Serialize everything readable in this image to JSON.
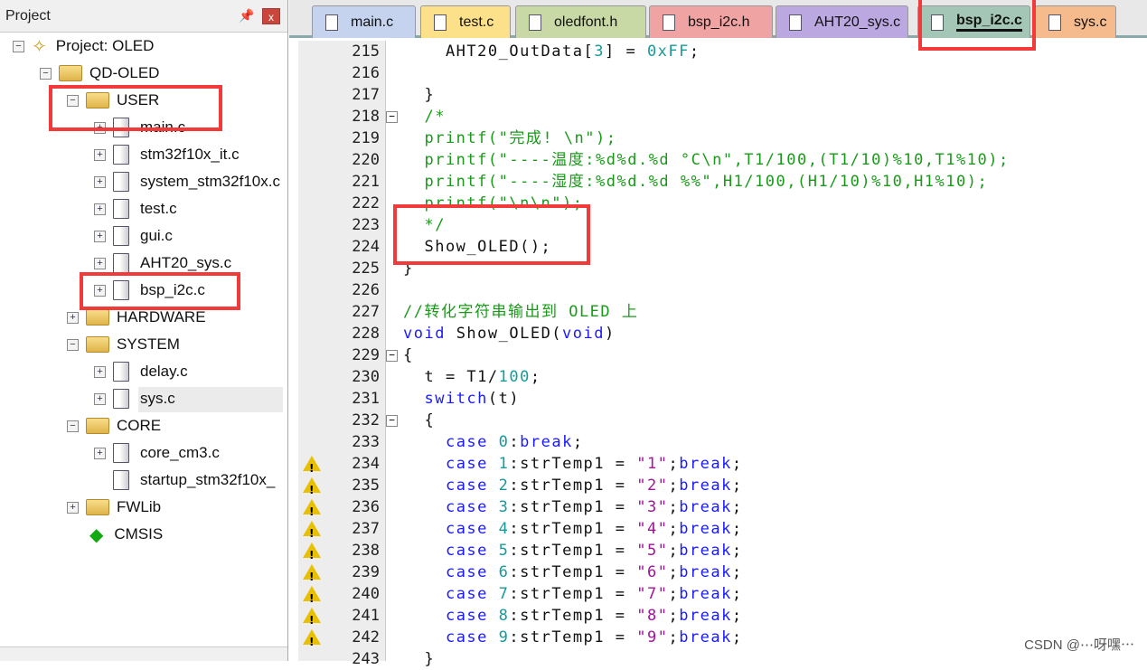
{
  "project_panel": {
    "title": "Project",
    "pin_icon": "pin-icon",
    "close_label": "x",
    "tree": [
      {
        "label": "Project: OLED",
        "icon": "project-icon",
        "expander": "−",
        "depth": 0
      },
      {
        "label": "QD-OLED",
        "icon": "target-folder-icon",
        "expander": "−",
        "depth": 1
      },
      {
        "label": "USER",
        "icon": "folder-open-icon",
        "expander": "−",
        "depth": 2
      },
      {
        "label": "main.c",
        "icon": "file-icon",
        "expander": "+",
        "depth": 3
      },
      {
        "label": "stm32f10x_it.c",
        "icon": "file-icon",
        "expander": "+",
        "depth": 3
      },
      {
        "label": "system_stm32f10x.c",
        "icon": "file-icon",
        "expander": "+",
        "depth": 3
      },
      {
        "label": "test.c",
        "icon": "file-icon",
        "expander": "+",
        "depth": 3
      },
      {
        "label": "gui.c",
        "icon": "file-icon",
        "expander": "+",
        "depth": 3
      },
      {
        "label": "AHT20_sys.c",
        "icon": "file-icon",
        "expander": "+",
        "depth": 3
      },
      {
        "label": "bsp_i2c.c",
        "icon": "file-icon",
        "expander": "+",
        "depth": 3
      },
      {
        "label": "HARDWARE",
        "icon": "folder-icon",
        "expander": "+",
        "depth": 2
      },
      {
        "label": "SYSTEM",
        "icon": "folder-open-icon",
        "expander": "−",
        "depth": 2
      },
      {
        "label": "delay.c",
        "icon": "file-icon",
        "expander": "+",
        "depth": 3
      },
      {
        "label": "sys.c",
        "icon": "file-icon",
        "expander": "+",
        "depth": 3,
        "selected": true
      },
      {
        "label": "CORE",
        "icon": "folder-open-icon",
        "expander": "−",
        "depth": 2
      },
      {
        "label": "core_cm3.c",
        "icon": "file-icon",
        "expander": "+",
        "depth": 3
      },
      {
        "label": "startup_stm32f10x_",
        "icon": "file-icon",
        "expander": "",
        "depth": 3
      },
      {
        "label": "FWLib",
        "icon": "folder-icon",
        "expander": "+",
        "depth": 2
      },
      {
        "label": "CMSIS",
        "icon": "cmsis-icon",
        "expander": "",
        "depth": 2
      }
    ]
  },
  "tabs": [
    {
      "label": "main.c",
      "color": "#c5d3ee"
    },
    {
      "label": "test.c",
      "color": "#fde08a"
    },
    {
      "label": "oledfont.h",
      "color": "#c9d9a6"
    },
    {
      "label": "bsp_i2c.h",
      "color": "#f0a3a3"
    },
    {
      "label": "AHT20_sys.c",
      "color": "#bba8e0"
    },
    {
      "label": "bsp_i2c.c",
      "color": "#a3c6b6",
      "active": true
    },
    {
      "label": "sys.c",
      "color": "#f6bb8c"
    }
  ],
  "editor": {
    "lines": [
      {
        "n": "215",
        "seg": [
          [
            "n",
            "    AHT20_OutData["
          ],
          [
            "nu",
            "3"
          ],
          [
            "n",
            "] = "
          ],
          [
            "nu",
            "0xFF"
          ],
          [
            "n",
            ";"
          ]
        ]
      },
      {
        "n": "216",
        "seg": []
      },
      {
        "n": "217",
        "seg": [
          [
            "n",
            "  }"
          ]
        ]
      },
      {
        "n": "218",
        "fold": "−",
        "seg": [
          [
            "c",
            "  /*"
          ]
        ]
      },
      {
        "n": "219",
        "seg": [
          [
            "c",
            "  printf(\"完成! \\n\");"
          ]
        ]
      },
      {
        "n": "220",
        "seg": [
          [
            "c",
            "  printf(\"----温度:%d%d.%d °C\\n\",T1/100,(T1/10)%10,T1%10);"
          ]
        ]
      },
      {
        "n": "221",
        "seg": [
          [
            "c",
            "  printf(\"----湿度:%d%d.%d %%\",H1/100,(H1/10)%10,H1%10);"
          ]
        ]
      },
      {
        "n": "222",
        "seg": [
          [
            "c",
            "  printf(\"\\n\\n\");"
          ]
        ]
      },
      {
        "n": "223",
        "seg": [
          [
            "c",
            "  */"
          ]
        ]
      },
      {
        "n": "224",
        "seg": [
          [
            "n",
            "  Show_OLED();"
          ]
        ]
      },
      {
        "n": "225",
        "seg": [
          [
            "n",
            "}"
          ]
        ]
      },
      {
        "n": "226",
        "seg": []
      },
      {
        "n": "227",
        "seg": [
          [
            "c",
            "//转化字符串输出到 OLED 上"
          ]
        ]
      },
      {
        "n": "228",
        "seg": [
          [
            "k",
            "void"
          ],
          [
            "n",
            " Show_OLED("
          ],
          [
            "k",
            "void"
          ],
          [
            "n",
            ")"
          ]
        ]
      },
      {
        "n": "229",
        "fold": "−",
        "seg": [
          [
            "n",
            "{"
          ]
        ]
      },
      {
        "n": "230",
        "seg": [
          [
            "n",
            "  t = T1/"
          ],
          [
            "nu",
            "100"
          ],
          [
            "n",
            ";"
          ]
        ]
      },
      {
        "n": "231",
        "seg": [
          [
            "n",
            "  "
          ],
          [
            "k",
            "switch"
          ],
          [
            "n",
            "(t)"
          ]
        ]
      },
      {
        "n": "232",
        "fold": "−",
        "seg": [
          [
            "n",
            "  {"
          ]
        ]
      },
      {
        "n": "233",
        "seg": [
          [
            "n",
            "    "
          ],
          [
            "k",
            "case"
          ],
          [
            "n",
            " "
          ],
          [
            "nu",
            "0"
          ],
          [
            "n",
            ":"
          ],
          [
            "k",
            "break"
          ],
          [
            "n",
            ";"
          ]
        ]
      },
      {
        "n": "234",
        "warn": true,
        "seg": [
          [
            "n",
            "    "
          ],
          [
            "k",
            "case"
          ],
          [
            "n",
            " "
          ],
          [
            "nu",
            "1"
          ],
          [
            "n",
            ":strTemp1 = "
          ],
          [
            "s",
            "\"1\""
          ],
          [
            "n",
            ";"
          ],
          [
            "k",
            "break"
          ],
          [
            "n",
            ";"
          ]
        ]
      },
      {
        "n": "235",
        "warn": true,
        "seg": [
          [
            "n",
            "    "
          ],
          [
            "k",
            "case"
          ],
          [
            "n",
            " "
          ],
          [
            "nu",
            "2"
          ],
          [
            "n",
            ":strTemp1 = "
          ],
          [
            "s",
            "\"2\""
          ],
          [
            "n",
            ";"
          ],
          [
            "k",
            "break"
          ],
          [
            "n",
            ";"
          ]
        ]
      },
      {
        "n": "236",
        "warn": true,
        "seg": [
          [
            "n",
            "    "
          ],
          [
            "k",
            "case"
          ],
          [
            "n",
            " "
          ],
          [
            "nu",
            "3"
          ],
          [
            "n",
            ":strTemp1 = "
          ],
          [
            "s",
            "\"3\""
          ],
          [
            "n",
            ";"
          ],
          [
            "k",
            "break"
          ],
          [
            "n",
            ";"
          ]
        ]
      },
      {
        "n": "237",
        "warn": true,
        "seg": [
          [
            "n",
            "    "
          ],
          [
            "k",
            "case"
          ],
          [
            "n",
            " "
          ],
          [
            "nu",
            "4"
          ],
          [
            "n",
            ":strTemp1 = "
          ],
          [
            "s",
            "\"4\""
          ],
          [
            "n",
            ";"
          ],
          [
            "k",
            "break"
          ],
          [
            "n",
            ";"
          ]
        ]
      },
      {
        "n": "238",
        "warn": true,
        "seg": [
          [
            "n",
            "    "
          ],
          [
            "k",
            "case"
          ],
          [
            "n",
            " "
          ],
          [
            "nu",
            "5"
          ],
          [
            "n",
            ":strTemp1 = "
          ],
          [
            "s",
            "\"5\""
          ],
          [
            "n",
            ";"
          ],
          [
            "k",
            "break"
          ],
          [
            "n",
            ";"
          ]
        ]
      },
      {
        "n": "239",
        "warn": true,
        "seg": [
          [
            "n",
            "    "
          ],
          [
            "k",
            "case"
          ],
          [
            "n",
            " "
          ],
          [
            "nu",
            "6"
          ],
          [
            "n",
            ":strTemp1 = "
          ],
          [
            "s",
            "\"6\""
          ],
          [
            "n",
            ";"
          ],
          [
            "k",
            "break"
          ],
          [
            "n",
            ";"
          ]
        ]
      },
      {
        "n": "240",
        "warn": true,
        "seg": [
          [
            "n",
            "    "
          ],
          [
            "k",
            "case"
          ],
          [
            "n",
            " "
          ],
          [
            "nu",
            "7"
          ],
          [
            "n",
            ":strTemp1 = "
          ],
          [
            "s",
            "\"7\""
          ],
          [
            "n",
            ";"
          ],
          [
            "k",
            "break"
          ],
          [
            "n",
            ";"
          ]
        ]
      },
      {
        "n": "241",
        "warn": true,
        "seg": [
          [
            "n",
            "    "
          ],
          [
            "k",
            "case"
          ],
          [
            "n",
            " "
          ],
          [
            "nu",
            "8"
          ],
          [
            "n",
            ":strTemp1 = "
          ],
          [
            "s",
            "\"8\""
          ],
          [
            "n",
            ";"
          ],
          [
            "k",
            "break"
          ],
          [
            "n",
            ";"
          ]
        ]
      },
      {
        "n": "242",
        "warn": true,
        "seg": [
          [
            "n",
            "    "
          ],
          [
            "k",
            "case"
          ],
          [
            "n",
            " "
          ],
          [
            "nu",
            "9"
          ],
          [
            "n",
            ":strTemp1 = "
          ],
          [
            "s",
            "\"9\""
          ],
          [
            "n",
            ";"
          ],
          [
            "k",
            "break"
          ],
          [
            "n",
            ";"
          ]
        ]
      },
      {
        "n": "243",
        "seg": [
          [
            "n",
            "  }"
          ]
        ]
      }
    ]
  },
  "watermark": "CSDN @⋯呀嘿⋯",
  "highlight_color": "#f23a3a"
}
